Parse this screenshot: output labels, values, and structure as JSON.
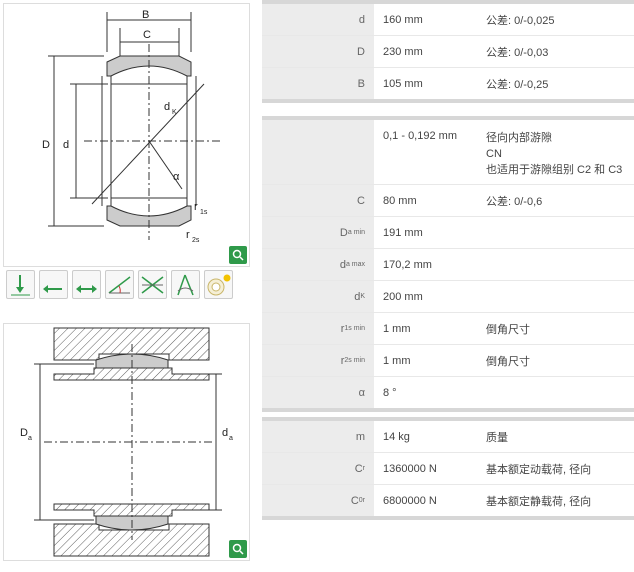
{
  "table1": [
    {
      "label": "d",
      "value": "160  mm",
      "note": "公差: 0/-0,025"
    },
    {
      "label": "D",
      "value": "230  mm",
      "note": "公差: 0/-0,03"
    },
    {
      "label": "B",
      "value": "105  mm",
      "note": "公差: 0/-0,25"
    }
  ],
  "table2": [
    {
      "label": "",
      "value": "0,1 - 0,192  mm",
      "note1": "径向内部游隙",
      "note2": "CN",
      "note3": "也适用于游隙组别 C2 和 C3"
    },
    {
      "label": "C",
      "value": "80  mm",
      "note": "公差: 0/-0,6"
    },
    {
      "label": "D",
      "sub": "a min",
      "value": "191  mm",
      "note": ""
    },
    {
      "label": "d",
      "sub": "a max",
      "value": "170,2  mm",
      "note": ""
    },
    {
      "label": "d",
      "sub": "K",
      "value": "200  mm",
      "note": ""
    },
    {
      "label": "r",
      "sub": "1s min",
      "value": "1  mm",
      "note": "倒角尺寸"
    },
    {
      "label": "r",
      "sub": "2s min",
      "value": "1  mm",
      "note": "倒角尺寸"
    },
    {
      "label": "α",
      "value": "8  °",
      "note": ""
    }
  ],
  "table3": [
    {
      "label": "m",
      "value": "14  kg",
      "note": "质量"
    },
    {
      "label": "C",
      "sub": "r",
      "value": "1360000  N",
      "note": "基本额定动载荷, 径向"
    },
    {
      "label": "C",
      "sub": "0r",
      "value": "6800000  N",
      "note": "基本额定静载荷, 径向"
    }
  ],
  "drawing1": {
    "B": "B",
    "C": "C",
    "D": "D",
    "d": "d",
    "dK": "d",
    "dK_sub": "K",
    "alpha": "α",
    "r1s": "r",
    "r1s_sub": "1s",
    "r2s": "r",
    "r2s_sub": "2s"
  },
  "drawing2": {
    "Da": "D",
    "Da_sub": "a",
    "da": "d",
    "da_sub": "a"
  },
  "colors": {
    "green": "#2f9a4a",
    "header": "#d7d7d7",
    "label_bg": "#ececec"
  }
}
